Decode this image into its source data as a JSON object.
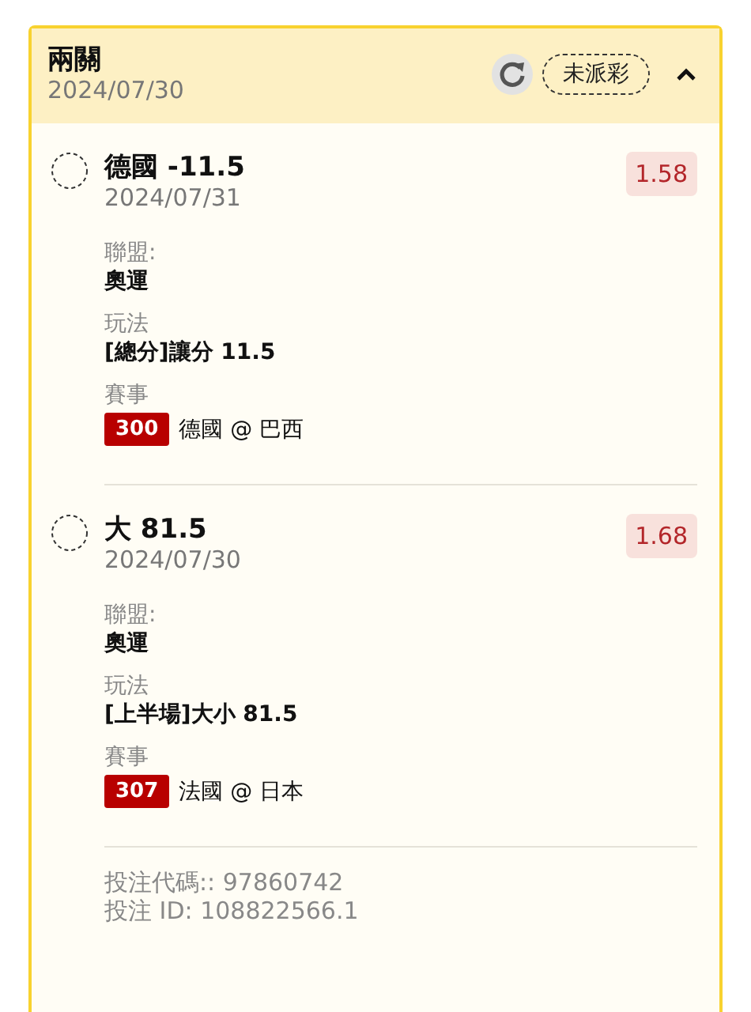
{
  "header": {
    "title": "兩關",
    "date": "2024/07/30",
    "status": "未派彩",
    "expanded": true
  },
  "legs": [
    {
      "title": "德國 -11.5",
      "date": "2024/07/31",
      "odds": "1.58",
      "fields": [
        {
          "label": "聯盟:",
          "value": "奧運"
        },
        {
          "label": "玩法",
          "value": "[總分]讓分 11.5"
        }
      ],
      "event_label": "賽事",
      "event_code": "300",
      "event_name": "德國 @ 巴西"
    },
    {
      "title": "大 81.5",
      "date": "2024/07/30",
      "odds": "1.68",
      "fields": [
        {
          "label": "聯盟:",
          "value": "奧運"
        },
        {
          "label": "玩法",
          "value": "[上半場]大小 81.5"
        }
      ],
      "event_label": "賽事",
      "event_code": "307",
      "event_name": "法國 @ 日本"
    }
  ],
  "footer": [
    "投注代碼:: 97860742",
    "投注 ID: 108822566.1"
  ]
}
